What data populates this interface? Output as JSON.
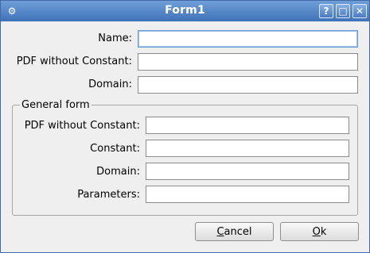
{
  "window": {
    "title": "Form1",
    "help_glyph": "?",
    "maximize_glyph": "□",
    "close_glyph": "✕",
    "app_icon": "gear-icon"
  },
  "form": {
    "name_label": "Name:",
    "name_value": "",
    "pdf_label": "PDF without Constant:",
    "pdf_value": "",
    "domain_label": "Domain:",
    "domain_value": ""
  },
  "general_form": {
    "title": "General form",
    "pdf_label": "PDF without Constant:",
    "pdf_value": "",
    "constant_label": "Constant:",
    "constant_value": "",
    "domain_label": "Domain:",
    "domain_value": "",
    "parameters_label": "Parameters:",
    "parameters_value": ""
  },
  "buttons": {
    "cancel_mnemonic": "C",
    "cancel_rest": "ancel",
    "ok_mnemonic": "O",
    "ok_rest": "k"
  }
}
